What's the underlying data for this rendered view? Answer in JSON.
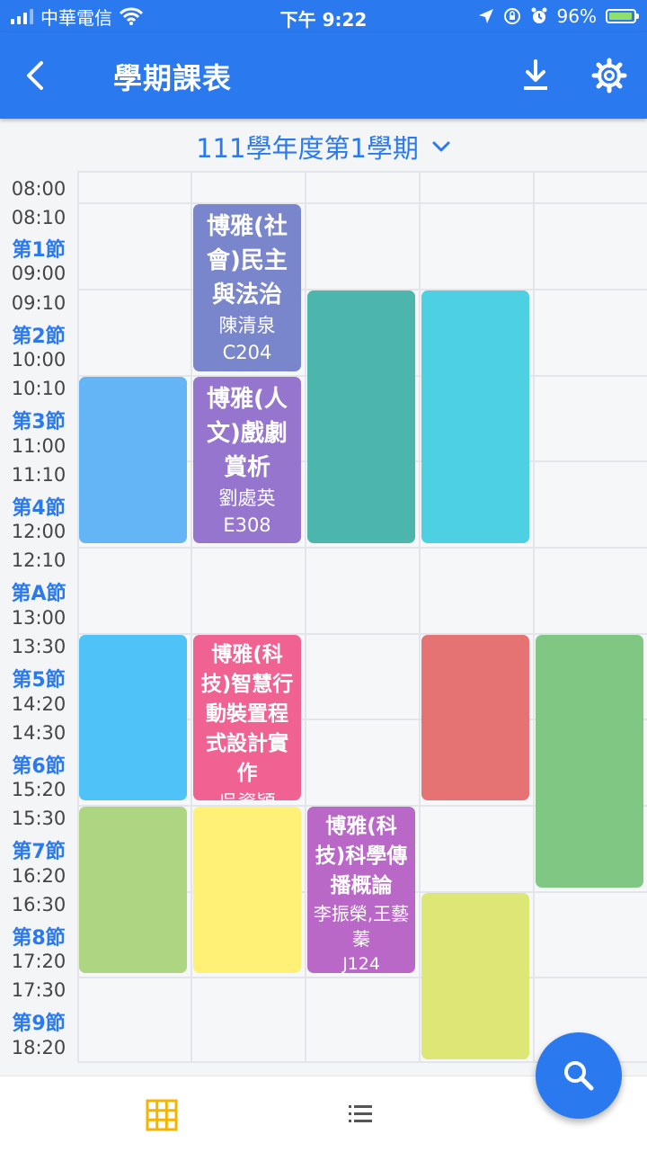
{
  "status_bar": {
    "carrier": "中華電信",
    "time": "下午 9:22",
    "battery": "96%",
    "battery_level": 0.96
  },
  "app_bar": {
    "title": "學期課表",
    "icons": [
      "back-icon",
      "download-icon",
      "gear-icon"
    ]
  },
  "semester": {
    "label": "111學年度第1學期"
  },
  "time_column": {
    "times": [
      "08:00",
      "08:10",
      "09:00",
      "09:10",
      "10:00",
      "10:10",
      "11:00",
      "11:10",
      "12:00",
      "12:10",
      "13:00",
      "13:30",
      "14:20",
      "14:30",
      "15:20",
      "15:30",
      "16:20",
      "16:30",
      "17:20",
      "17:30",
      "18:20"
    ],
    "periods": [
      "第1節",
      "第2節",
      "第3節",
      "第4節",
      "第A節",
      "第5節",
      "第6節",
      "第7節",
      "第8節",
      "第9節"
    ]
  },
  "courses": [
    {
      "name": "博雅(社會)民主與法治",
      "teacher": "陳清泉",
      "room": "C204",
      "color": "#7986cb"
    },
    {
      "name": "博雅(人文)戲劇賞析",
      "teacher": "劉處英",
      "room": "E308",
      "color": "#9575cd"
    },
    {
      "name": "博雅(科技)智慧行動裝置程式設計實作",
      "teacher": "吳資穎",
      "room": "",
      "color": "#f06292"
    },
    {
      "name": "博雅(科技)科學傳播概論",
      "teacher": "李振榮,王藝蓁",
      "room": "J124",
      "color": "#ba68c8"
    },
    {
      "name": "",
      "color": "#64b5f6"
    },
    {
      "name": "",
      "color": "#4db6ac"
    },
    {
      "name": "",
      "color": "#4dd0e1"
    },
    {
      "name": "",
      "color": "#4fc3f7"
    },
    {
      "name": "",
      "color": "#e57373"
    },
    {
      "name": "",
      "color": "#81c784"
    },
    {
      "name": "",
      "color": "#aed581"
    },
    {
      "name": "",
      "color": "#fff176"
    },
    {
      "name": "",
      "color": "#dce775"
    }
  ],
  "bottom_bar": {
    "tabs": [
      {
        "icon": "grid-icon",
        "active": true,
        "color": "#f4b400"
      },
      {
        "icon": "list-icon",
        "active": false,
        "color": "#555555"
      }
    ]
  },
  "fab": {
    "icon": "search-icon"
  }
}
